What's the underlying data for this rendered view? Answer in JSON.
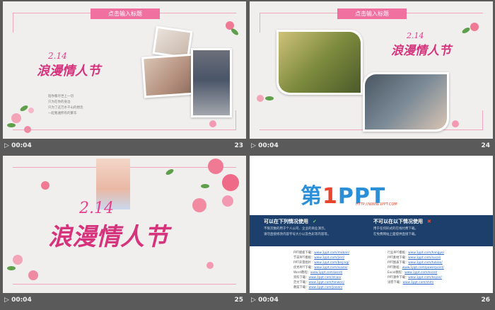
{
  "slides": [
    {
      "time": "00:04",
      "number": "23",
      "title": "点击输入标题",
      "logo_date": "2.14",
      "logo_text": "浪漫情人节",
      "poem": [
        "陪你看尽世上一切",
        "只为在你的身边",
        "只为了这万水千山的想念",
        "一起看遍所有的繁华"
      ]
    },
    {
      "time": "00:04",
      "number": "24",
      "title": "点击输入标题",
      "logo_date": "2.14",
      "logo_text": "浪漫情人节"
    },
    {
      "time": "00:04",
      "number": "25",
      "logo_date": "2.14",
      "logo_text": "浪漫情人节"
    },
    {
      "time": "00:04",
      "number": "26",
      "logo_mark_a": "第",
      "logo_mark_b": "1",
      "logo_mark_c": "PPT",
      "logo_url": "HTTP://WWW.1PPT.COM",
      "allowed_head": "可以在下列情况使用",
      "allowed_lines": [
        "不限次数的用于个人公司、企业的商业演示。",
        "请勿直接修改内容字号大小以及色彩等内容等。"
      ],
      "forbidden_head": "不可以在以下情况使用",
      "forbidden_lines": [
        "用于任何形式的在线付费下载。",
        "在免费网站上面提供直接下载。"
      ],
      "links_left": [
        {
          "label": "PPT模板下载：",
          "url": "www.1ppt.com/moban/"
        },
        {
          "label": "节日PPT模板：",
          "url": "www.1ppt.com/jieri/"
        },
        {
          "label": "PPT背景图片：",
          "url": "www.1ppt.com/beijing/"
        },
        {
          "label": "优秀PPT下载：",
          "url": "www.1ppt.com/xiazai/"
        },
        {
          "label": "Word教程：",
          "url": "www.1ppt.com/word/"
        },
        {
          "label": "资料下载：",
          "url": "www.1ppt.com/ziliao/"
        },
        {
          "label": "范文下载：",
          "url": "www.1ppt.com/fanwen/"
        },
        {
          "label": "教案下载：",
          "url": "www.1ppt.com/jiaoan/"
        }
      ],
      "links_right": [
        {
          "label": "行业PPT模板：",
          "url": "www.1ppt.com/hangye/"
        },
        {
          "label": "PPT素材下载：",
          "url": "www.1ppt.com/sucai/"
        },
        {
          "label": "PPT图表下载：",
          "url": "www.1ppt.com/tubiao/"
        },
        {
          "label": "PPT教程：",
          "url": "www.1ppt.com/powerpoint/"
        },
        {
          "label": "Excel教程：",
          "url": "www.1ppt.com/excel/"
        },
        {
          "label": "PPT课件下载：",
          "url": "www.1ppt.com/kejian/"
        },
        {
          "label": "试卷下载：",
          "url": "www.1ppt.com/shiti/"
        }
      ]
    }
  ],
  "colors": {
    "accent": "#f0709f",
    "frame": "#f2a7bf",
    "band": "#1c3f6b",
    "brand_blue": "#2b8fd8",
    "brand_red": "#e8452e"
  },
  "icons": {
    "play": "play-icon",
    "check": "check-icon",
    "cross": "cross-icon"
  }
}
